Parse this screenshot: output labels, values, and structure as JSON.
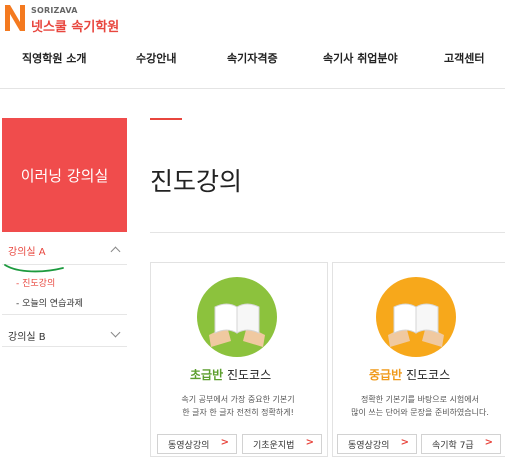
{
  "brand": {
    "en": "SORIZAVA",
    "ko": "넷스쿨 속기학원"
  },
  "nav": [
    "직영학원 소개",
    "수강안내",
    "속기자격증",
    "속기사 취업분야",
    "고객센터"
  ],
  "sidebar": {
    "title": "이러닝 강의실",
    "sections": [
      {
        "label": "강의실 A",
        "expanded": true,
        "items": [
          "- 진도강의",
          "- 오늘의 연습과제"
        ]
      },
      {
        "label": "강의실 B",
        "expanded": false
      }
    ]
  },
  "page": {
    "title": "진도강의"
  },
  "courses": [
    {
      "level": "초급반",
      "name": "진도코스",
      "desc": [
        "속기 공부에서 가장 중요한 기본기",
        "한 글자 한 글자 전전히 정확하게!"
      ],
      "buttons": [
        "동영상강의",
        "기초운지법"
      ],
      "circle_color": "#8cc23d"
    },
    {
      "level": "중급반",
      "name": "진도코스",
      "desc": [
        "정확한 기본기를 바탕으로 시험에서",
        "많이 쓰는 단어와 문장을 준비하였습니다."
      ],
      "buttons": [
        "동영상강의",
        "속기학 7급"
      ],
      "circle_color": "#f7a81b"
    }
  ],
  "colors": {
    "accent": "#e8463e",
    "sidebar_bg": "#f04c4c",
    "level_beginner": "#5c9e2e",
    "level_intermediate": "#f09a1a"
  }
}
